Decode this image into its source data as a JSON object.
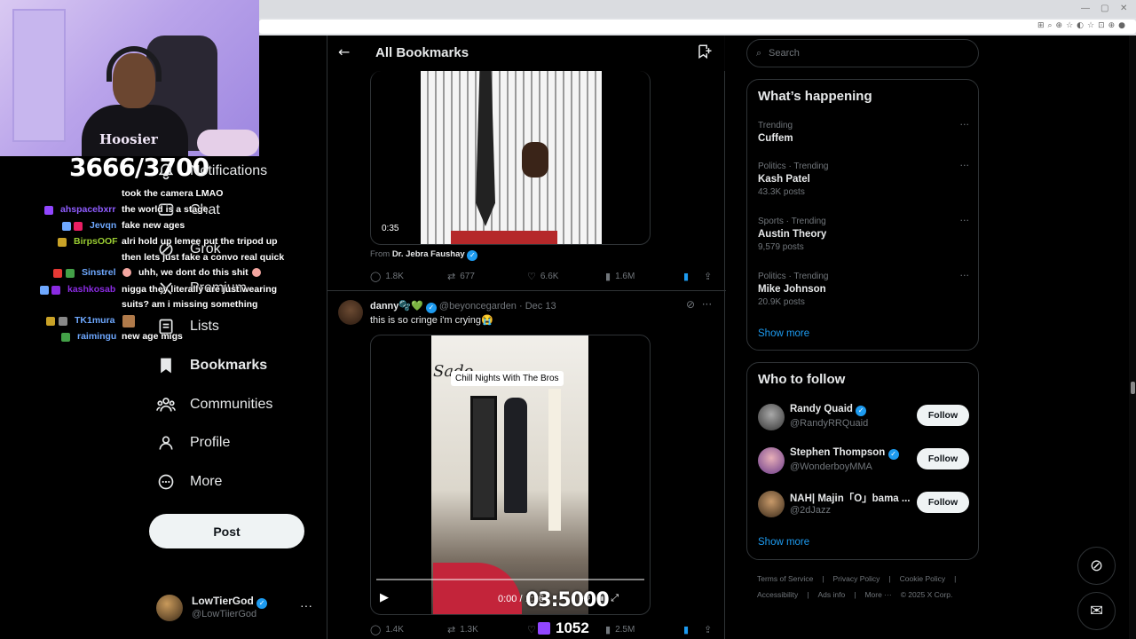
{
  "stream": {
    "follower_counter": "3666/3700",
    "timer": "03:5000",
    "viewers": "1052",
    "shirt_text": "Hoosier"
  },
  "chat": [
    {
      "user": "",
      "user_color": "#ffffff",
      "text": "took the camera LMAO"
    },
    {
      "user": "ahspacebxrr",
      "user_color": "#8f5cff",
      "text": "the world is a stage"
    },
    {
      "user": "Jevqn",
      "user_color": "#6ea8ff",
      "text": "fake new ages"
    },
    {
      "user": "BirpsOOF",
      "user_color": "#9acd32",
      "text": "alri hold up lemee put the tripod up"
    },
    {
      "user": "",
      "user_color": "#ffffff",
      "text": "then lets just fake a convo real quick"
    },
    {
      "user": "Sinstrel",
      "user_color": "#6ea8ff",
      "text": "uhh, we dont do this shit"
    },
    {
      "user": "kashkosab",
      "user_color": "#8a2be2",
      "text": "nigga they literally are just wearing"
    },
    {
      "user": "",
      "user_color": "#ffffff",
      "text": "suits? am i missing something"
    },
    {
      "user": "TK1mura",
      "user_color": "#6ea8ff",
      "text": ""
    },
    {
      "user": "raimingu",
      "user_color": "#6ea8ff",
      "text": "new age migs"
    }
  ],
  "nav": {
    "items": [
      {
        "label": "Notifications",
        "icon": "bell-icon"
      },
      {
        "label": "Chat",
        "icon": "chat-icon"
      },
      {
        "label": "Grok",
        "icon": "grok-icon"
      },
      {
        "label": "Premium",
        "icon": "x-logo-icon"
      },
      {
        "label": "Lists",
        "icon": "list-icon"
      },
      {
        "label": "Bookmarks",
        "icon": "bookmark-icon"
      },
      {
        "label": "Communities",
        "icon": "communities-icon"
      },
      {
        "label": "Profile",
        "icon": "profile-icon"
      },
      {
        "label": "More",
        "icon": "more-icon"
      }
    ],
    "post_label": "Post",
    "account": {
      "name": "LowTierGod",
      "handle": "@LowTiierGod"
    }
  },
  "header": {
    "title": "All Bookmarks"
  },
  "tweet1": {
    "video_duration": "0:35",
    "from_label": "From",
    "from_name": "Dr. Jebra Faushay",
    "replies": "1.8K",
    "reposts": "677",
    "likes": "6.6K",
    "views": "1.6M"
  },
  "tweet2": {
    "name": "danny🫧💚",
    "handle": "@beyoncegarden",
    "date": "Dec 13",
    "text": "this is so cringe i'm crying😭",
    "caption": "Chill Nights With The Bros",
    "painting_text": "Sade",
    "time": "0:00 / 1:26",
    "replies": "1.4K",
    "reposts": "1.3K",
    "views": "2.5M"
  },
  "search": {
    "placeholder": "Search"
  },
  "happening": {
    "title": "What’s happening",
    "trends": [
      {
        "cat": "Trending",
        "name": "Cuffem",
        "posts": ""
      },
      {
        "cat": "Politics · Trending",
        "name": "Kash Patel",
        "posts": "43.3K posts"
      },
      {
        "cat": "Sports · Trending",
        "name": "Austin Theory",
        "posts": "9,579 posts"
      },
      {
        "cat": "Politics · Trending",
        "name": "Mike Johnson",
        "posts": "20.9K posts"
      }
    ],
    "show_more": "Show more"
  },
  "who_to_follow": {
    "title": "Who to follow",
    "accounts": [
      {
        "name": "Randy Quaid",
        "handle": "@RandyRRQuaid"
      },
      {
        "name": "Stephen Thompson",
        "handle": "@WonderboyMMA"
      },
      {
        "name": "NAH| Majin「O」bama ...",
        "handle": "@2dJazz"
      }
    ],
    "follow_label": "Follow",
    "show_more": "Show more"
  },
  "footer": {
    "row1": [
      "Terms of Service",
      "|",
      "Privacy Policy",
      "|",
      "Cookie Policy",
      "|"
    ],
    "row2": [
      "Accessibility",
      "|",
      "Ads info",
      "|",
      "More ···",
      "© 2025 X Corp."
    ]
  },
  "colors": {
    "accent": "#1d9bf0",
    "background": "#000000",
    "border": "#2f3336"
  }
}
